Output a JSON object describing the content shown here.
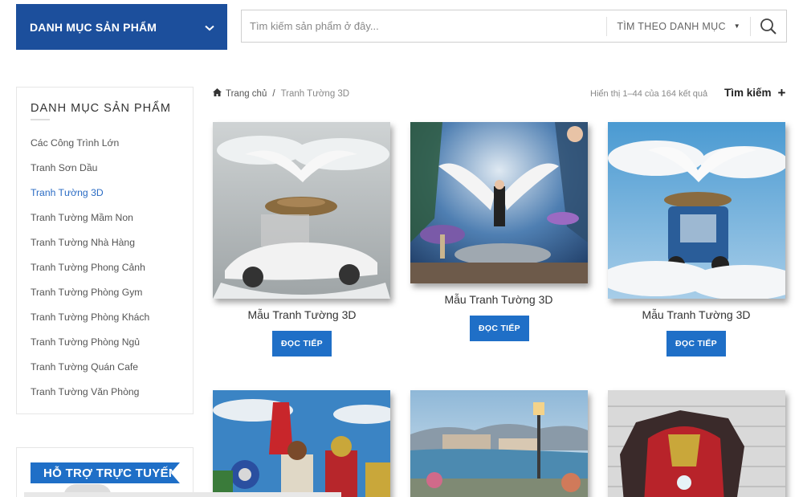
{
  "header": {
    "category_button": "DANH MỤC SẢN PHẨM",
    "search_placeholder": "Tìm kiếm sản phẩm ở đây...",
    "search_category": "TÌM THEO DANH MỤC"
  },
  "sidebar": {
    "title": "DANH MỤC SẢN PHẨM",
    "items": [
      {
        "label": "Các Công Trình Lớn"
      },
      {
        "label": "Tranh Sơn Dầu"
      },
      {
        "label": "Tranh Tường 3D",
        "active": true
      },
      {
        "label": "Tranh Tường Mầm Non"
      },
      {
        "label": "Tranh Tường Nhà Hàng"
      },
      {
        "label": "Tranh Tường Phong Cảnh"
      },
      {
        "label": "Tranh Tường Phòng Gym"
      },
      {
        "label": "Tranh Tường Phòng Khách"
      },
      {
        "label": "Tranh Tường Phòng Ngủ"
      },
      {
        "label": "Tranh Tường Quán Cafe"
      },
      {
        "label": "Tranh Tường Văn Phòng"
      }
    ],
    "support_title": "HỖ TRỢ TRỰC TUYẾN"
  },
  "breadcrumb": {
    "home": "Trang chủ",
    "separator": "/",
    "current": "Tranh Tường 3D"
  },
  "results": {
    "count_text": "Hiển thị 1–44 của 164 kết quả",
    "filter_label": "Tìm kiếm",
    "filter_icon": "+"
  },
  "products": [
    {
      "title": "Mẫu Tranh Tường 3D",
      "button": "ĐỌC TIẾP"
    },
    {
      "title": "Mẫu Tranh Tường 3D",
      "button": "ĐỌC TIẾP"
    },
    {
      "title": "Mẫu Tranh Tường 3D",
      "button": "ĐỌC TIẾP"
    }
  ],
  "colors": {
    "brand": "#1c4f9c",
    "accent": "#1f6fc7",
    "active_link": "#2b6cc4"
  }
}
